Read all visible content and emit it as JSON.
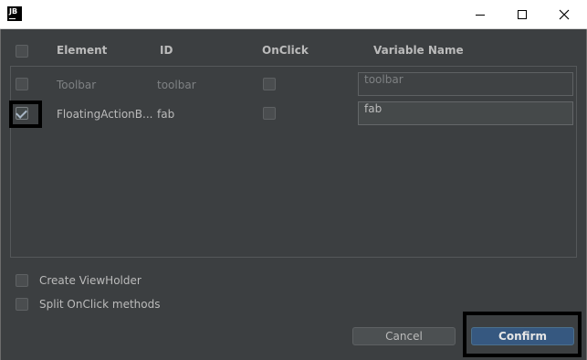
{
  "titlebar": {
    "app_icon_text": "JB",
    "icons": {
      "minimize": "minimize-icon",
      "maximize": "maximize-icon",
      "close": "close-icon"
    }
  },
  "table": {
    "headers": {
      "element": "Element",
      "id": "ID",
      "onclick": "OnClick",
      "variable_name": "Variable Name"
    },
    "select_all_checked": false,
    "rows": [
      {
        "checked": false,
        "element": "Toolbar",
        "id": "toolbar",
        "onclick": false,
        "variable_name": "toolbar"
      },
      {
        "checked": true,
        "element": "FloatingActionB...",
        "id": "fab",
        "onclick": false,
        "variable_name": "fab"
      }
    ]
  },
  "options": {
    "create_viewholder": {
      "label": "Create ViewHolder",
      "checked": false
    },
    "split_onclick": {
      "label": "Split OnClick methods",
      "checked": false
    }
  },
  "buttons": {
    "cancel": "Cancel",
    "confirm": "Confirm"
  },
  "colors": {
    "background": "#3c3f41",
    "confirm_button": "#365880",
    "highlight_box": "#000000"
  }
}
